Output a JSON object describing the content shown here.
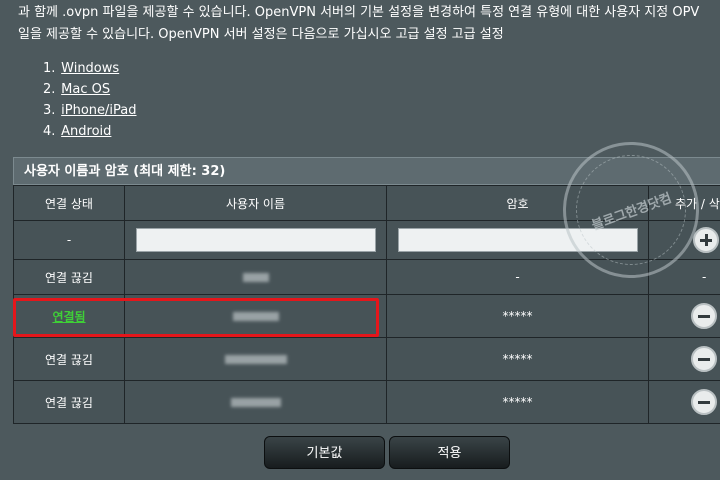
{
  "intro": {
    "line1": "과 함께 .ovpn 파일을 제공할 수 있습니다. OpenVPN 서버의 기본 설정을 변경하여 특정 연결 유형에 대한 사용자 지정 OPV",
    "line2": "일을 제공할 수 있습니다. OpenVPN 서버 설정은 다음으로 가십시오 고급 설정 고급 설정"
  },
  "clients": [
    {
      "num": "1.",
      "label": "Windows"
    },
    {
      "num": "2.",
      "label": "Mac OS"
    },
    {
      "num": "3.",
      "label": "iPhone/iPad"
    },
    {
      "num": "4.",
      "label": "Android"
    }
  ],
  "table": {
    "title": "사용자 이름과 암호 (최대 제한: 32)",
    "headers": {
      "status": "연결 상태",
      "username": "사용자 이름",
      "password": "암호",
      "action": "추가 / 삭"
    },
    "input_row": {
      "status": "-",
      "username_value": "",
      "password_value": ""
    },
    "rows": [
      {
        "status": "연결 끊김",
        "password": "-",
        "action": "-"
      },
      {
        "status": "연결됨",
        "password": "*****"
      },
      {
        "status": "연결 끊김",
        "password": "*****"
      },
      {
        "status": "연결 끊김",
        "password": "*****"
      }
    ]
  },
  "watermark": {
    "text": "블로그한경닷컴"
  },
  "buttons": {
    "default": "기본값",
    "apply": "적용"
  },
  "colors": {
    "connected": "#3fcf37",
    "highlight": "#e5161b"
  }
}
